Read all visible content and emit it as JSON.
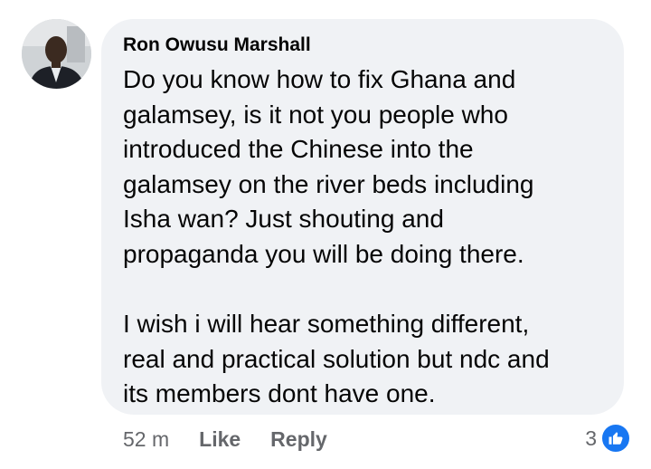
{
  "comment": {
    "author": "Ron Owusu Marshall",
    "paragraphs": [
      "Do you know how to fix Ghana and\ngalamsey, is it not you people who\nintroduced the Chinese into the\ngalamsey on the river beds including\nIsha wan? Just shouting and\npropaganda you will be doing there.",
      "I wish i will hear something different,\nreal and practical solution but ndc and\nits members dont have one."
    ]
  },
  "actions": {
    "time": "52 m",
    "like": "Like",
    "reply": "Reply"
  },
  "reactions": {
    "count": "3",
    "icon": "thumbs-up-icon",
    "color": "#1877f2"
  }
}
